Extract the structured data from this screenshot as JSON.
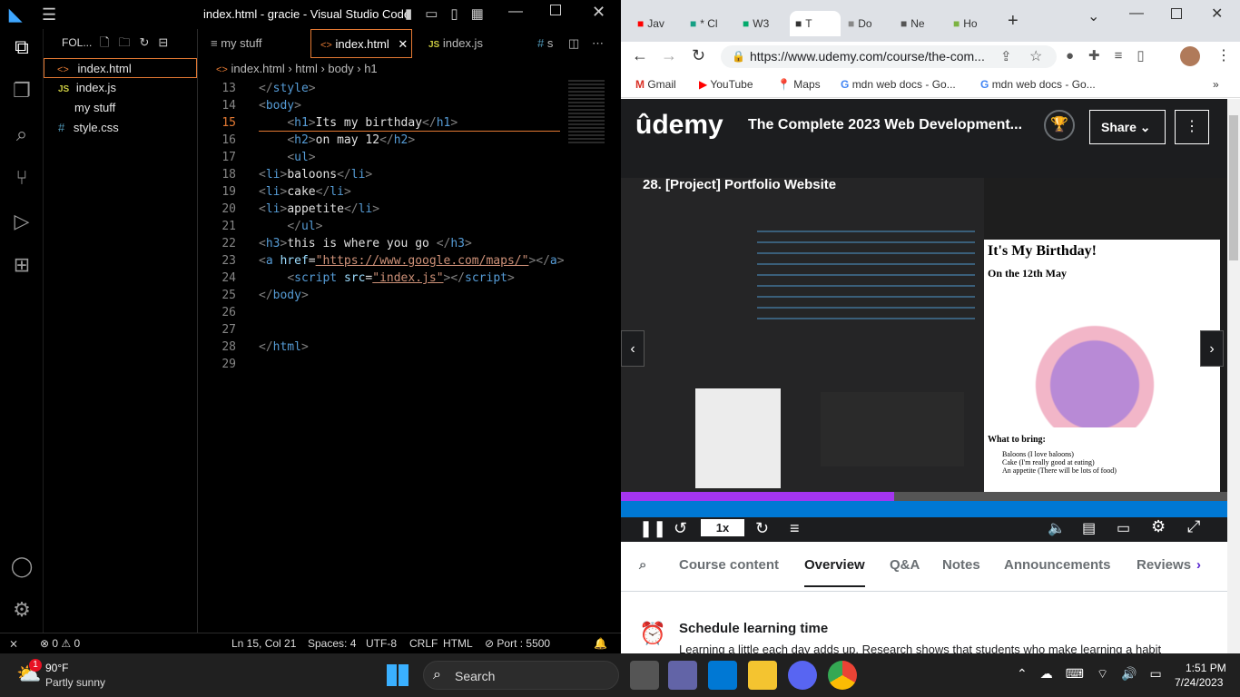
{
  "vscode": {
    "title": "index.html - gracie - Visual Studio Code",
    "sidebar_header": "FOL...",
    "files": [
      {
        "icon": "<>",
        "name": "index.html",
        "color": "#e37933"
      },
      {
        "icon": "JS",
        "name": "index.js",
        "color": "#cbcb41"
      },
      {
        "icon": "",
        "name": "my stuff",
        "color": "#ccc"
      },
      {
        "icon": "#",
        "name": "style.css",
        "color": "#519aba"
      }
    ],
    "tabs": [
      "my stuff",
      "index.html",
      "index.js",
      "s"
    ],
    "breadcrumb": [
      "index.html",
      "html",
      "body",
      "h1"
    ],
    "line_numbers": [
      "13",
      "14",
      "15",
      "16",
      "17",
      "18",
      "19",
      "20",
      "21",
      "22",
      "23",
      "24",
      "25",
      "26",
      "27",
      "28",
      "29"
    ],
    "status": {
      "errors": "0",
      "warnings": "0",
      "pos": "Ln 15, Col 21",
      "spaces": "Spaces: 4",
      "enc": "UTF-8",
      "eol": "CRLF",
      "lang": "HTML",
      "port": "Port : 5500"
    }
  },
  "chrome": {
    "tabs": [
      "Jav",
      "* Cl",
      "W3",
      "T",
      "Do",
      "Ne",
      "Ho"
    ],
    "url": "https://www.udemy.com/course/the-com...",
    "bookmarks": [
      "Gmail",
      "YouTube",
      "Maps",
      "mdn web docs - Go...",
      "mdn web docs - Go..."
    ]
  },
  "udemy": {
    "logo": "ûdemy",
    "course_title": "The Complete 2023 Web Development...",
    "share": "Share",
    "lecture": "28. [Project] Portfolio Website",
    "speed": "1x",
    "tabs": [
      "Course content",
      "Overview",
      "Q&A",
      "Notes",
      "Announcements",
      "Reviews"
    ],
    "schedule_title": "Schedule learning time",
    "schedule_text": "Learning a little each day adds up. Research shows that students who make learning a habit",
    "video_preview": {
      "h1": "It's My Birthday!",
      "h3": "On the 12th May",
      "bring": "What to bring:",
      "items": [
        "Baloons (I love baloons)",
        "Cake (I'm really good at eating)",
        "An appetite (There will be lots of food)"
      ]
    }
  },
  "taskbar": {
    "temp": "90°F",
    "weather": "Partly sunny",
    "badge": "1",
    "search": "Search",
    "time": "1:51 PM",
    "date": "7/24/2023"
  }
}
